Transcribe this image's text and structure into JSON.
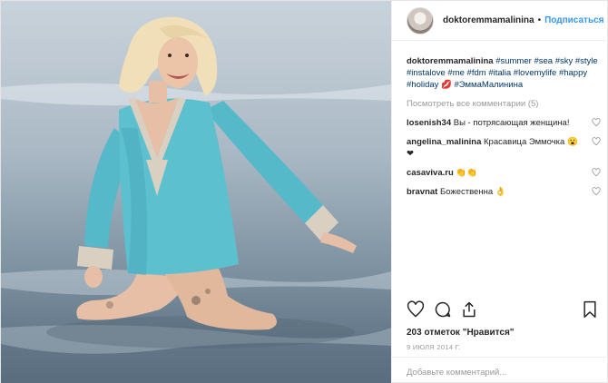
{
  "header": {
    "username": "doktoremmamalinina",
    "separator": "•",
    "follow_label": "Подписаться"
  },
  "caption": {
    "username": "doktoremmamalinina",
    "tags": [
      "#summer",
      "#sea",
      "#sky",
      "#style",
      "#instalove",
      "#me",
      "#fdm",
      "#italia",
      "#lovemylife",
      "#happy",
      "#holiday",
      "💋",
      "#ЭммаМалинина"
    ]
  },
  "view_all_comments": "Посмотреть все комментарии (5)",
  "comments": [
    {
      "user": "losenish34",
      "text": "Вы - потрясающая женщина!"
    },
    {
      "user": "angelina_malinina",
      "text": "Красавица Эммочка 😮❤"
    },
    {
      "user": "casaviva.ru",
      "text": "👏👏"
    },
    {
      "user": "bravnat",
      "text": "Божественна 👌"
    }
  ],
  "likes": "203 отметок \"Нравится\"",
  "date": "9 ИЮЛЯ 2014 Г.",
  "add_comment_placeholder": "Добавьте комментарий...",
  "icons": {
    "like": "heart-icon",
    "comment": "comment-icon",
    "share": "share-icon",
    "save": "bookmark-icon"
  },
  "colors": {
    "accent": "#3897f0",
    "hashtag": "#003569",
    "dress": "#56b9c9"
  }
}
